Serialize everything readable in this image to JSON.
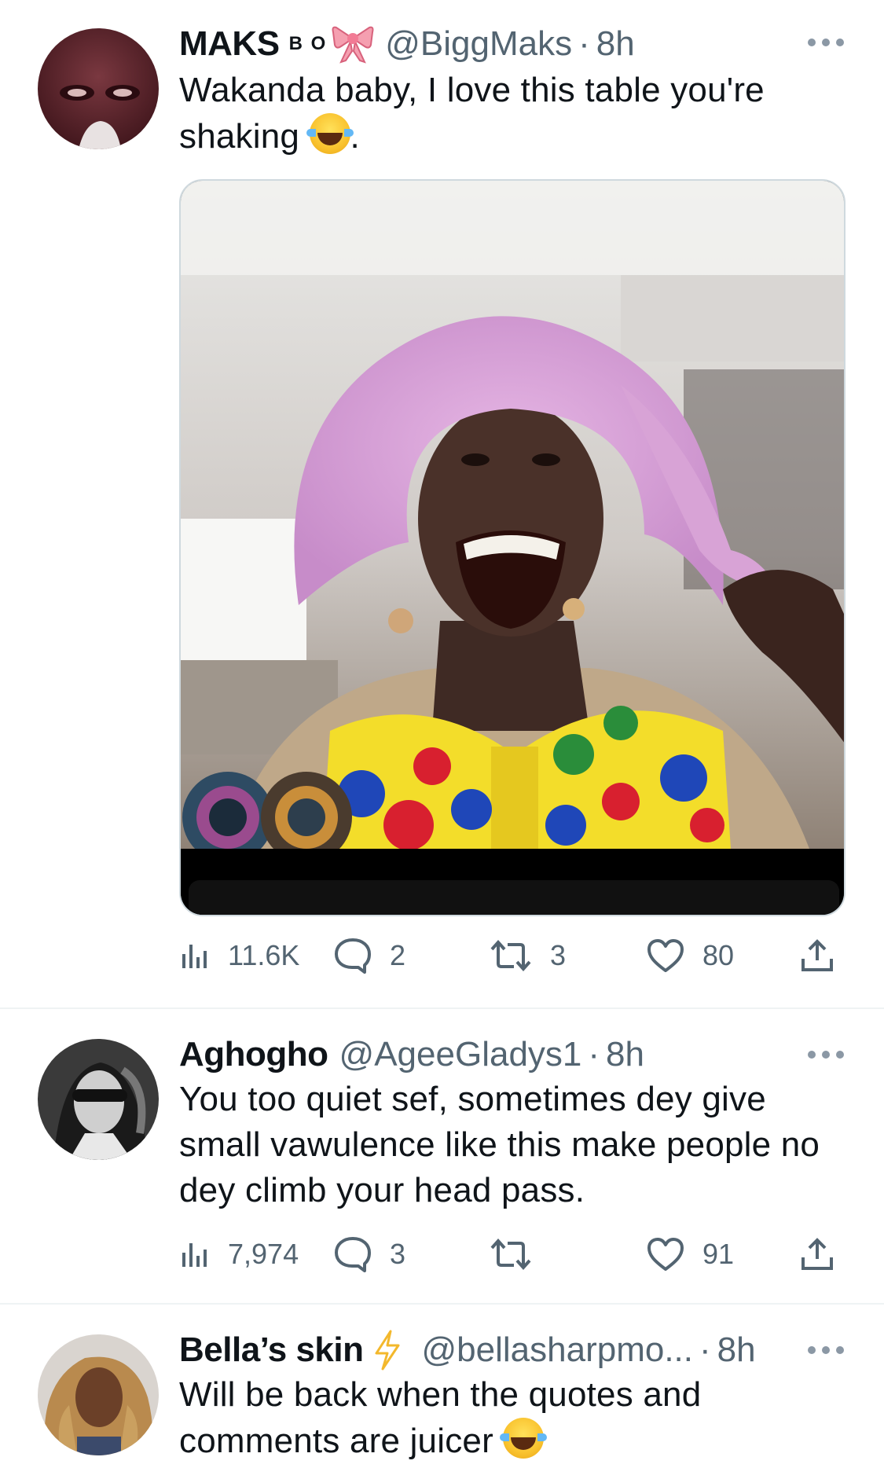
{
  "tweets": [
    {
      "name": "MAKS",
      "name_suffix": "B O",
      "handle": "@BiggMaks",
      "time": "8h",
      "text": "Wakanda baby, I love this table you're shaking",
      "text_end": ".",
      "emoji": "face-with-tears-of-joy",
      "views": "11.6K",
      "replies": "2",
      "retweets": "3",
      "likes": "80"
    },
    {
      "name": "Aghogho",
      "handle": "@AgeeGladys1",
      "time": "8h",
      "text": "You too quiet sef, sometimes dey give small vawulence like this make people no dey climb your head pass.",
      "views": "7,974",
      "replies": "3",
      "retweets": "",
      "likes": "91"
    },
    {
      "name": "Bella’s skin",
      "handle": "@bellasharpmo...",
      "time": "8h",
      "text": "Will be back when the quotes and comments are juicer",
      "emoji": "face-with-tears-of-joy"
    }
  ],
  "separator": "·",
  "colors": {
    "text": "#0f1419",
    "secondary": "#536471",
    "divider": "#eff3f4",
    "wig_pink": "#d99ad8",
    "bow_yellow": "#f3dd2a"
  }
}
